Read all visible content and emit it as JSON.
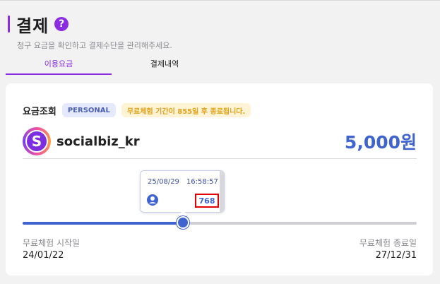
{
  "page": {
    "title": "결제",
    "help_icon": "?",
    "subtitle": "청구 요금을 확인하고 결제수단을 관리해주세요."
  },
  "tabs": [
    {
      "label": "이용요금",
      "active": true
    },
    {
      "label": "결제내역",
      "active": false
    }
  ],
  "billing": {
    "lookup_label": "요금조회",
    "plan_badge": "PERSONAL",
    "trial_notice": "무료체험 기간이 855일 후 종료됩니다.",
    "account_initial": "S",
    "account_name": "socialbiz_kr",
    "price": "5,000원"
  },
  "tooltip": {
    "date": "25/08/29",
    "time": "16:58:57",
    "value": "768",
    "icon": "user-circle-icon"
  },
  "trial_timeline": {
    "progress": 0.406,
    "start_label": "무료체험 시작일",
    "start_date": "24/01/22",
    "end_label": "무료체험 종료일",
    "end_date": "27/12/31"
  },
  "colors": {
    "accent": "#8b2be2",
    "primary_blue": "#3f63cf",
    "highlight_red": "#e00000",
    "trial_yellow": "#e0a21a"
  }
}
